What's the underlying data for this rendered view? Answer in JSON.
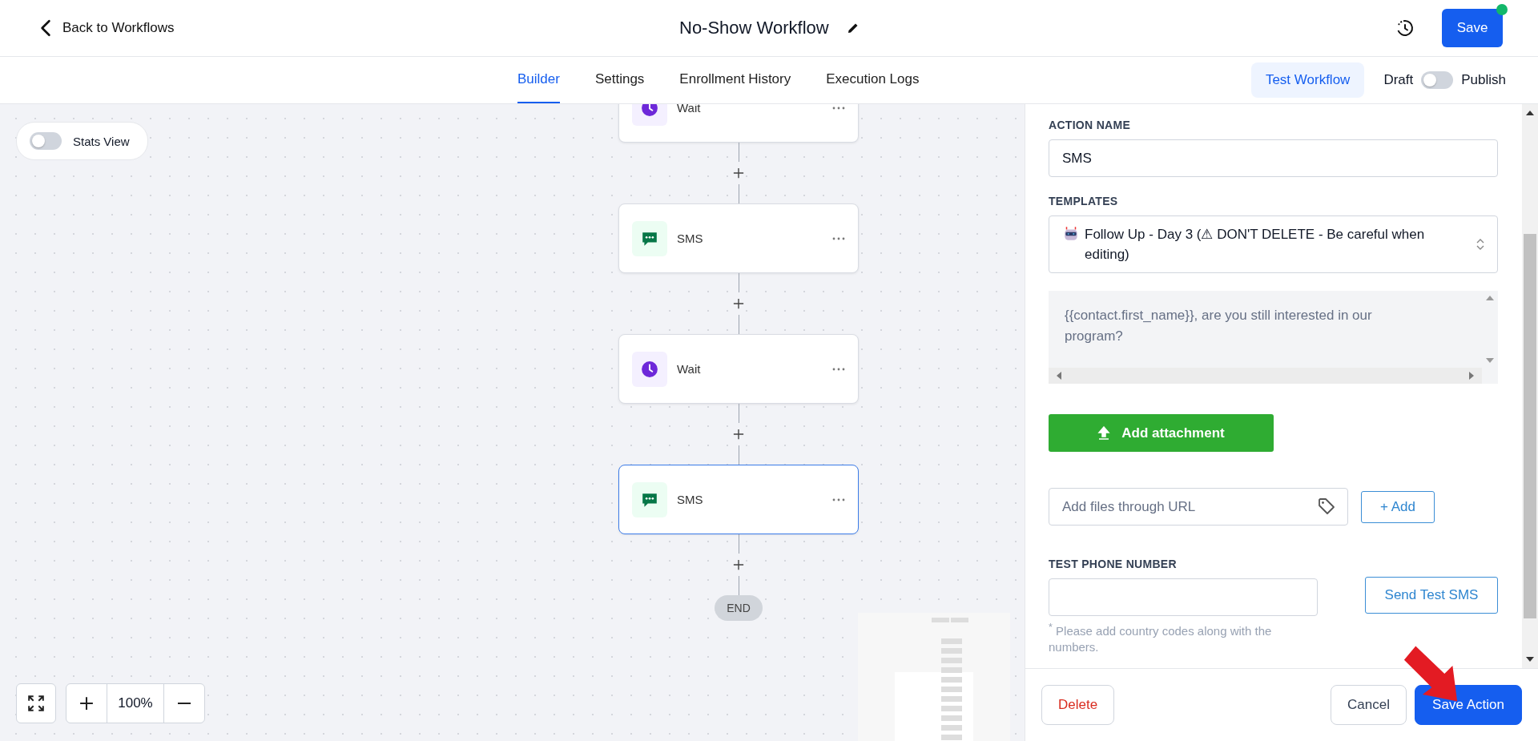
{
  "header": {
    "back_link": "Back to Workflows",
    "title": "No-Show Workflow",
    "save_button": "Save",
    "save_indicator": true
  },
  "tabs": [
    {
      "label": "Builder",
      "selected": true
    },
    {
      "label": "Settings",
      "selected": false
    },
    {
      "label": "Enrollment History",
      "selected": false
    },
    {
      "label": "Execution Logs",
      "selected": false
    }
  ],
  "test_button": "Test Workflow",
  "publish_toggle": {
    "off_label": "Draft",
    "on_label": "Publish",
    "on": false
  },
  "stats_toggle": {
    "label": "Stats View",
    "on": false
  },
  "nodes": [
    {
      "kind": "wait",
      "label": "Wait",
      "selected": false
    },
    {
      "kind": "sms",
      "label": "SMS",
      "selected": false
    },
    {
      "kind": "wait",
      "label": "Wait",
      "selected": false
    },
    {
      "kind": "sms",
      "label": "SMS",
      "selected": true
    }
  ],
  "end_label": "END",
  "zoom_text": "100%",
  "panel": {
    "action_name_label": "ACTION NAME",
    "action_name": "SMS",
    "templates_label": "TEMPLATES",
    "template": "Follow Up - Day 3 (⚠ DON'T DELETE - Be careful when editing)",
    "message": "{{contact.first_name}}, are you still interested in our program?",
    "attachment_button": "Add attachment",
    "url_placeholder": "Add files through URL",
    "add_button": "+ Add",
    "phone_label": "TEST PHONE NUMBER",
    "phone_hint": "$^{*}$ Please add country codes along with the numbers.",
    "send_test_button": "Send Test SMS",
    "delete_button": "Delete",
    "cancel_button": "Cancel",
    "save_action_button": "Save Action"
  }
}
